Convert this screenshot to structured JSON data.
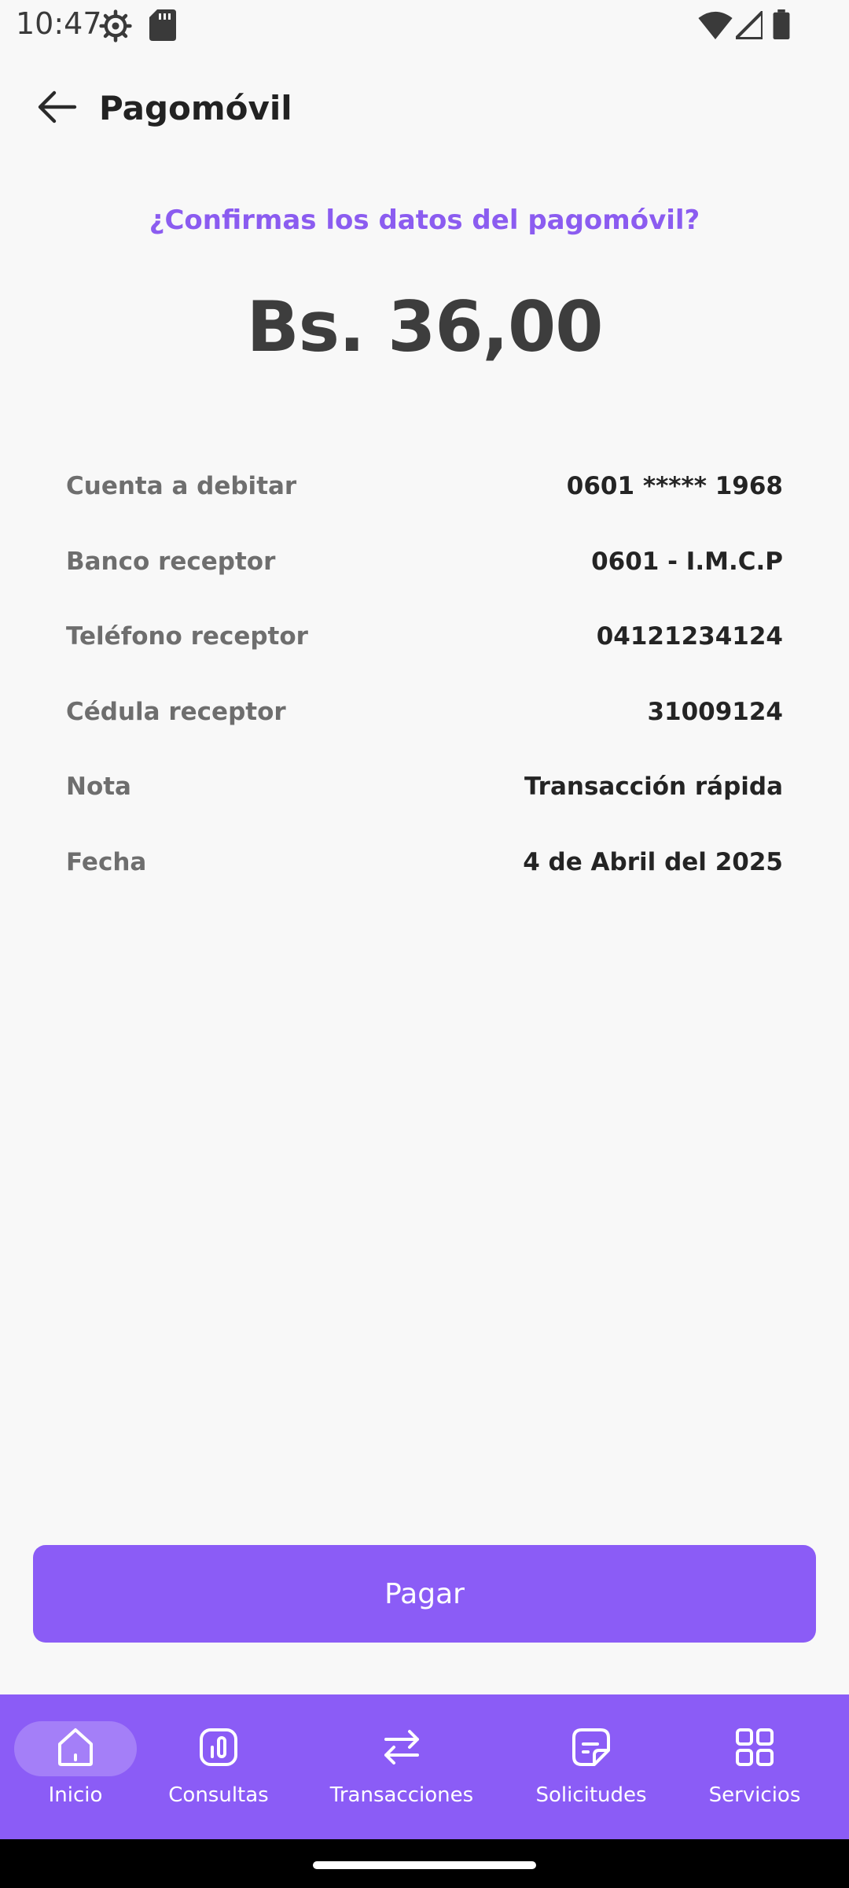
{
  "status_bar": {
    "time": "10:47",
    "icons": [
      "settings-icon",
      "sd-card-icon",
      "wifi-icon",
      "signal-icon",
      "battery-icon"
    ]
  },
  "app_bar": {
    "title": "Pagomóvil",
    "back_icon": "arrow-left-icon"
  },
  "confirm": {
    "question": "¿Confirmas los datos del pagomóvil?",
    "amount": "Bs. 36,00"
  },
  "details": [
    {
      "label": "Cuenta a debitar",
      "value": "0601 ***** 1968"
    },
    {
      "label": "Banco receptor",
      "value": "0601 - I.M.C.P"
    },
    {
      "label": "Teléfono receptor",
      "value": "04121234124"
    },
    {
      "label": "Cédula receptor",
      "value": "31009124"
    },
    {
      "label": "Nota",
      "value": "Transacción rápida"
    },
    {
      "label": "Fecha",
      "value": "4 de Abril del 2025"
    }
  ],
  "pay_button": {
    "label": "Pagar"
  },
  "bottom_nav": {
    "items": [
      {
        "label": "Inicio",
        "icon": "home-icon",
        "active": true
      },
      {
        "label": "Consultas",
        "icon": "chart-icon",
        "active": false
      },
      {
        "label": "Transacciones",
        "icon": "transfer-icon",
        "active": false
      },
      {
        "label": "Solicitudes",
        "icon": "document-icon",
        "active": false
      },
      {
        "label": "Servicios",
        "icon": "grid-icon",
        "active": false
      }
    ]
  },
  "colors": {
    "accent": "#8b5cf6",
    "background": "#f8f8f8",
    "amount_text": "#3d3d3d"
  }
}
